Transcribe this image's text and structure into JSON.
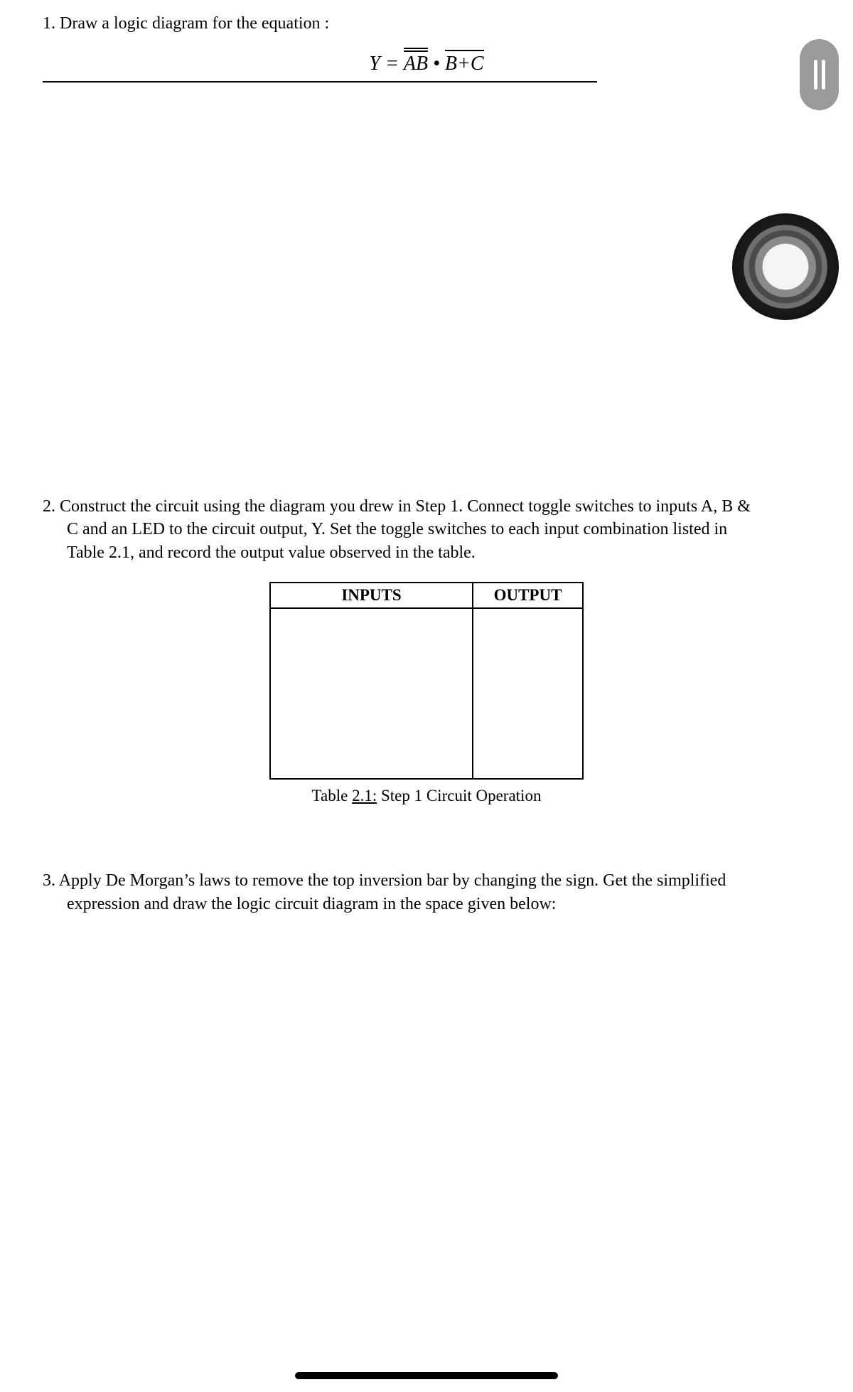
{
  "q1": {
    "number": "1.",
    "text": "Draw a logic diagram for the equation :",
    "equation": {
      "lhs": "Y",
      "equals": " = ",
      "term1_over_inner": "AB",
      "dot": " • ",
      "term2_over": "B+C"
    }
  },
  "q2": {
    "number": "2.",
    "line1": "Construct the circuit using the diagram you drew in Step 1. Connect toggle switches to inputs A, B &",
    "line2": "C and an LED to the circuit output, Y. Set the toggle switches to each input combination listed in",
    "line3": "Table 2.1, and record the output value observed in the table.",
    "table": {
      "header_inputs": "INPUTS",
      "header_output": "OUTPUT",
      "caption_prefix": "Table ",
      "caption_num": "2.1:",
      "caption_rest": " Step 1 Circuit Operation"
    }
  },
  "q3": {
    "number": "3.",
    "line1": "Apply De Morgan’s laws to remove the top inversion bar by changing the sign. Get the simplified",
    "line2": "expression and draw the logic circuit diagram in the space given below:"
  }
}
